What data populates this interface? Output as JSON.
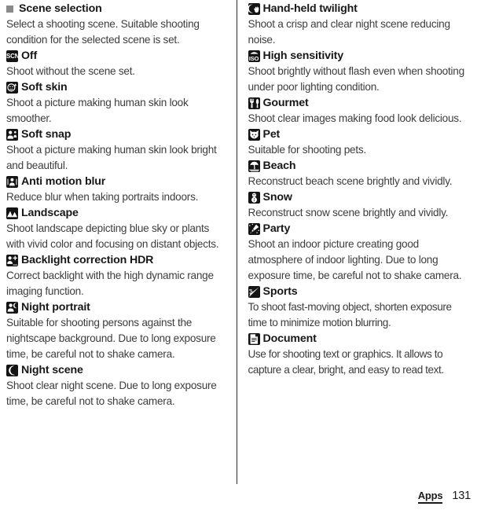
{
  "document": {
    "footer": {
      "section_label": "Apps",
      "page_number": "131"
    }
  },
  "left_column": {
    "section": {
      "bullet_icon": "gray-square-bullet",
      "heading": "Scene selection",
      "description": "Select a shooting scene. Suitable shooting condition for the selected scene is set."
    },
    "items": [
      {
        "icon": "scn-icon",
        "icon_text": "SCN",
        "title": "Off",
        "description": "Shoot without the scene set."
      },
      {
        "icon": "soft-skin-face-icon",
        "title": "Soft skin",
        "description": "Shoot a picture making human skin look smoother."
      },
      {
        "icon": "soft-snap-person-icon",
        "title": "Soft snap",
        "description": "Shoot a picture making human skin look bright and beautiful."
      },
      {
        "icon": "anti-motion-blur-icon",
        "title": "Anti motion blur",
        "description": "Reduce blur when taking portraits indoors."
      },
      {
        "icon": "landscape-mountains-icon",
        "title": "Landscape",
        "description": "Shoot landscape depicting blue sky or plants with vivid color and focusing on distant objects."
      },
      {
        "icon": "backlight-hdr-icon",
        "title": "Backlight correction HDR",
        "description": "Correct backlight with the high dynamic range imaging function."
      },
      {
        "icon": "night-portrait-icon",
        "title": "Night portrait",
        "description": "Suitable for shooting persons against the nightscape background. Due to long exposure time, be careful not to shake camera."
      },
      {
        "icon": "night-scene-moon-icon",
        "title": "Night scene",
        "description": "Shoot clear night scene. Due to long exposure time, be careful not to shake camera."
      }
    ]
  },
  "right_column": {
    "items": [
      {
        "icon": "hand-held-twilight-icon",
        "title": "Hand-held twilight",
        "description": "Shoot a crisp and clear night scene reducing noise."
      },
      {
        "icon": "high-sensitivity-iso-icon",
        "icon_text": "ISO",
        "title": "High sensitivity",
        "description": "Shoot brightly without flash even when shooting under poor lighting condition."
      },
      {
        "icon": "gourmet-cutlery-icon",
        "title": "Gourmet",
        "description": "Shoot clear images making food look delicious."
      },
      {
        "icon": "pet-cat-icon",
        "title": "Pet",
        "description": "Suitable for shooting pets."
      },
      {
        "icon": "beach-umbrella-icon",
        "title": "Beach",
        "description": "Reconstruct beach scene brightly and vividly."
      },
      {
        "icon": "snow-snowman-icon",
        "title": "Snow",
        "description": "Reconstruct snow scene brightly and vividly."
      },
      {
        "icon": "party-confetti-icon",
        "title": "Party",
        "description": "Shoot an indoor picture creating good atmosphere of indoor lighting. Due to long exposure time, be careful not to shake camera."
      },
      {
        "icon": "sports-running-icon",
        "title": "Sports",
        "description": "To shoot fast-moving object, shorten exposure time to minimize motion blurring."
      },
      {
        "icon": "document-page-icon",
        "title": "Document",
        "description": "Use for shooting text or graphics. It allows to capture a clear, bright, and easy to read text."
      }
    ]
  }
}
